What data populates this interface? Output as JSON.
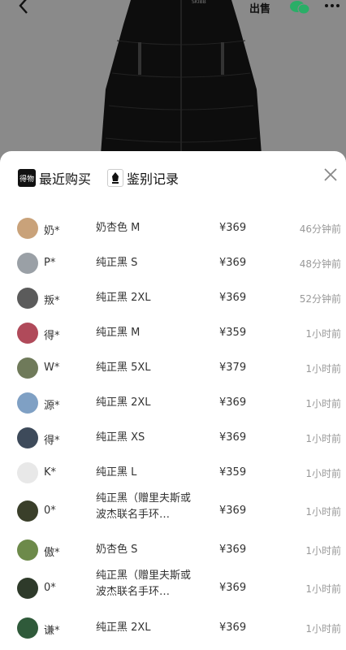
{
  "header": {
    "back_icon": "back-chevron-icon",
    "sell_icon": "sell-icon",
    "sell_label": "出售",
    "share_icon": "wechat-icon",
    "more_icon": "more-icon"
  },
  "sheet": {
    "tabs": [
      {
        "label": "最近购买",
        "badge": "得物",
        "icon": "dewu-badge-icon"
      },
      {
        "label": "鉴别记录",
        "icon": "auth-seal-icon"
      }
    ],
    "close_icon": "close-icon",
    "records": [
      {
        "user": "奶*",
        "variant": "奶杏色 M",
        "price": "¥369",
        "time": "46分钟前"
      },
      {
        "user": "P*",
        "variant": "纯正黑 S",
        "price": "¥369",
        "time": "48分钟前"
      },
      {
        "user": "叛*",
        "variant": "纯正黑 2XL",
        "price": "¥369",
        "time": "52分钟前"
      },
      {
        "user": "得*",
        "variant": "纯正黑 M",
        "price": "¥359",
        "time": "1小时前"
      },
      {
        "user": "W*",
        "variant": "纯正黑 5XL",
        "price": "¥379",
        "time": "1小时前"
      },
      {
        "user": "源*",
        "variant": "纯正黑 2XL",
        "price": "¥369",
        "time": "1小时前"
      },
      {
        "user": "得*",
        "variant": "纯正黑 XS",
        "price": "¥369",
        "time": "1小时前"
      },
      {
        "user": "K*",
        "variant": "纯正黑 L",
        "price": "¥359",
        "time": "1小时前"
      },
      {
        "user": "0*",
        "variant": "纯正黑（赠里夫斯或波杰联名手环…",
        "price": "¥369",
        "time": "1小时前"
      },
      {
        "user": "傲*",
        "variant": "奶杏色 S",
        "price": "¥369",
        "time": "1小时前"
      },
      {
        "user": "0*",
        "variant": "纯正黑（赠里夫斯或波杰联名手环…",
        "price": "¥369",
        "time": "1小时前"
      },
      {
        "user": "谦*",
        "variant": "纯正黑 2XL",
        "price": "¥369",
        "time": "1小时前"
      }
    ]
  },
  "colors": {
    "overlay_bg": "#8a8a8a",
    "sheet_bg": "#ffffff",
    "text_primary": "#333333",
    "text_secondary": "#999999",
    "badge_bg": "#111111"
  }
}
